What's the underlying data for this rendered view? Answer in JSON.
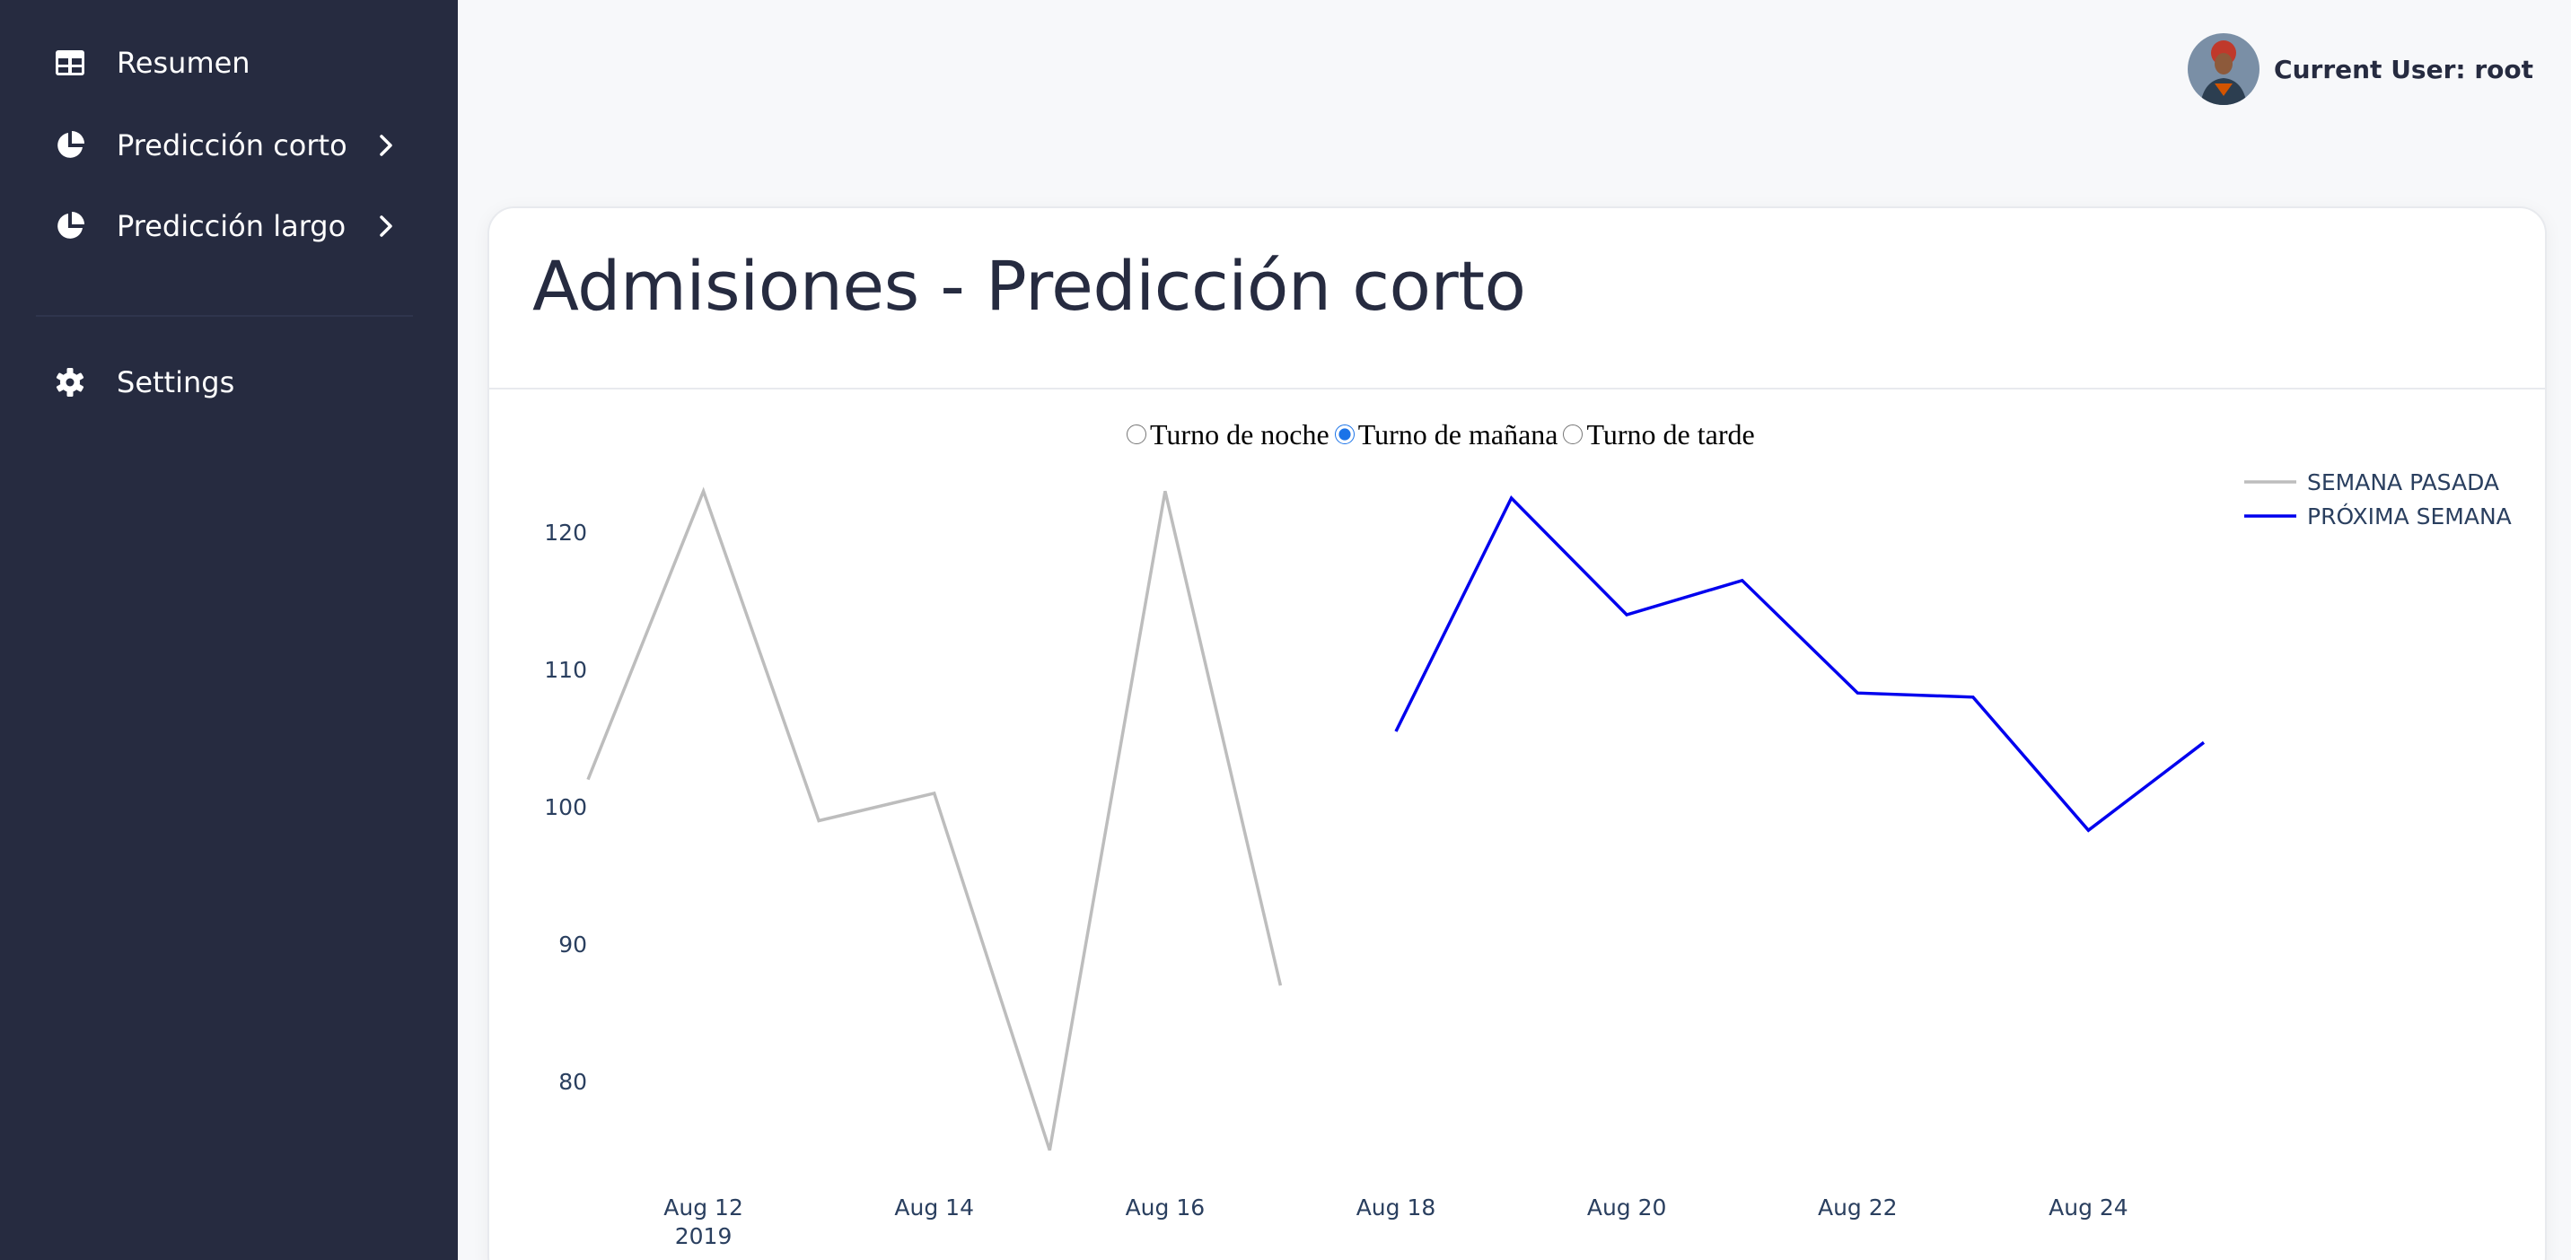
{
  "sidebar": {
    "items": [
      {
        "label": "Resumen",
        "icon": "table-icon"
      },
      {
        "label": "Predicción corto",
        "icon": "pie-chart-icon"
      },
      {
        "label": "Predicción largo",
        "icon": "pie-chart-icon"
      },
      {
        "label": "Settings",
        "icon": "gear-icon"
      }
    ]
  },
  "header": {
    "user_label": "Current User: root"
  },
  "card": {
    "title": "Admisiones - Predicción corto"
  },
  "shift_selector": {
    "options": [
      "Turno de noche",
      "Turno de mañana",
      "Turno de tarde"
    ],
    "selected": "Turno de mañana"
  },
  "colors": {
    "sidebar_bg": "#262b40",
    "past_week": "#bdbdbd",
    "next_week": "#0000ee"
  },
  "chart_data": {
    "type": "line",
    "title": "",
    "xlabel": "",
    "ylabel": "",
    "xlim": [
      "2019-08-11",
      "2019-08-25"
    ],
    "ylim": [
      74,
      124
    ],
    "y_ticks": [
      80,
      90,
      100,
      110,
      120
    ],
    "x_ticks": [
      {
        "date": "2019-08-12",
        "label": "Aug 12",
        "sublabel": "2019"
      },
      {
        "date": "2019-08-14",
        "label": "Aug 14"
      },
      {
        "date": "2019-08-16",
        "label": "Aug 16"
      },
      {
        "date": "2019-08-18",
        "label": "Aug 18"
      },
      {
        "date": "2019-08-20",
        "label": "Aug 20"
      },
      {
        "date": "2019-08-22",
        "label": "Aug 22"
      },
      {
        "date": "2019-08-24",
        "label": "Aug 24"
      }
    ],
    "legend_position": "top-right",
    "series": [
      {
        "name": "SEMANA PASADA",
        "color": "#bdbdbd",
        "x": [
          "2019-08-11",
          "2019-08-12",
          "2019-08-13",
          "2019-08-14",
          "2019-08-15",
          "2019-08-16",
          "2019-08-17"
        ],
        "y": [
          102,
          123,
          99,
          101,
          75,
          123,
          87
        ]
      },
      {
        "name": "PRÓXIMA SEMANA",
        "color": "#0000ee",
        "x": [
          "2019-08-18",
          "2019-08-19",
          "2019-08-20",
          "2019-08-21",
          "2019-08-22",
          "2019-08-23",
          "2019-08-24",
          "2019-08-25"
        ],
        "y": [
          105.5,
          122.5,
          114,
          116.5,
          108.3,
          108,
          98.3,
          104.7
        ]
      }
    ]
  }
}
